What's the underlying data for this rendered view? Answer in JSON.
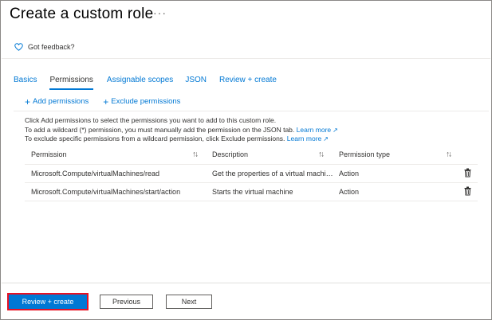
{
  "header": {
    "title": "Create a custom role",
    "more_label": "···",
    "feedback_label": "Got feedback?"
  },
  "tabs": [
    {
      "label": "Basics",
      "active": false
    },
    {
      "label": "Permissions",
      "active": true
    },
    {
      "label": "Assignable scopes",
      "active": false
    },
    {
      "label": "JSON",
      "active": false
    },
    {
      "label": "Review + create",
      "active": false
    }
  ],
  "toolbar": {
    "add_label": "Add permissions",
    "exclude_label": "Exclude permissions"
  },
  "info": {
    "line1": "Click Add permissions to select the permissions you want to add to this custom role.",
    "line2": "To add a wildcard (*) permission, you must manually add the permission on the JSON tab.",
    "line3": "To exclude specific permissions from a wildcard permission, click Exclude permissions.",
    "learn_more": "Learn more"
  },
  "grid": {
    "columns": [
      "Permission",
      "Description",
      "Permission type"
    ],
    "rows": [
      {
        "permission": "Microsoft.Compute/virtualMachines/read",
        "description": "Get the properties of a virtual machine",
        "type": "Action"
      },
      {
        "permission": "Microsoft.Compute/virtualMachines/start/action",
        "description": "Starts the virtual machine",
        "type": "Action"
      }
    ]
  },
  "footer": {
    "review_label": "Review + create",
    "previous_label": "Previous",
    "next_label": "Next"
  },
  "colors": {
    "accent": "#0078d4",
    "highlight": "#e81123"
  }
}
